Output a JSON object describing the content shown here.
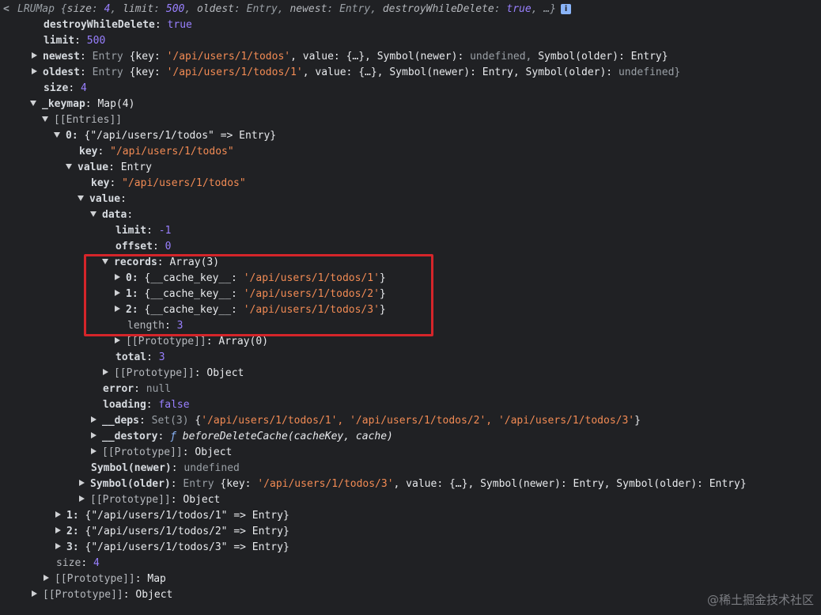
{
  "header": {
    "back_glyph": "<",
    "class_name": "LRUMap",
    "preview_open": "{",
    "preview_size_key": "size",
    "preview_size_val": "4",
    "preview_limit_key": "limit",
    "preview_limit_val": "500",
    "preview_oldest_key": "oldest",
    "preview_oldest_val": "Entry",
    "preview_newest_key": "newest",
    "preview_newest_val": "Entry",
    "preview_dwd_key": "destroyWhileDelete",
    "preview_dwd_val": "true",
    "preview_close": "…}",
    "info_glyph": "i"
  },
  "props": {
    "destroyWhileDelete": {
      "key": "destroyWhileDelete",
      "value": "true"
    },
    "limit": {
      "key": "limit",
      "value": "500"
    },
    "newest": {
      "key": "newest",
      "type": "Entry",
      "open": "{key:",
      "key_value": "'/api/users/1/todos'",
      "value_label": "value:",
      "value_preview": "{…},",
      "sym_newer_label": "Symbol(newer):",
      "sym_newer_val": "undefined,",
      "sym_older_label": "Symbol(older):",
      "sym_older_val": "Entry}"
    },
    "oldest": {
      "key": "oldest",
      "type": "Entry",
      "open": "{key:",
      "key_value": "'/api/users/1/todos/1'",
      "value_label": "value:",
      "value_preview": "{…},",
      "sym_newer_label": "Symbol(newer):",
      "sym_newer_val": "Entry,",
      "sym_older_label": "Symbol(older):",
      "sym_older_val": "undefined}"
    },
    "size": {
      "key": "size",
      "value": "4"
    }
  },
  "keymap": {
    "key": "_keymap",
    "type": "Map(4)",
    "entries_label": "[[Entries]]",
    "entry0": {
      "index": "0:",
      "summary_open": "{",
      "summary_key": "\"/api/users/1/todos\"",
      "summary_rest": "=> Entry}",
      "key_label": "key",
      "key_value": "\"/api/users/1/todos\"",
      "value_label": "value",
      "value_type": "Entry",
      "inner_key_label": "key",
      "inner_key_value": "\"/api/users/1/todos\"",
      "inner_value_label": "value",
      "data_label": "data",
      "limit_label": "limit",
      "limit_value": "-1",
      "offset_label": "offset",
      "offset_value": "0",
      "records_label": "records",
      "records_type": "Array(3)",
      "records": [
        {
          "index": "0:",
          "open": "{__cache_key__:",
          "value": "'/api/users/1/todos/1'",
          "close": "}"
        },
        {
          "index": "1:",
          "open": "{__cache_key__:",
          "value": "'/api/users/1/todos/2'",
          "close": "}"
        },
        {
          "index": "2:",
          "open": "{__cache_key__:",
          "value": "'/api/users/1/todos/3'",
          "close": "}"
        }
      ],
      "length_label": "length",
      "length_value": "3",
      "array_proto_label": "[[Prototype]]",
      "array_proto_value": "Array(0)",
      "total_label": "total",
      "total_value": "3",
      "data_proto_label": "[[Prototype]]",
      "data_proto_value": "Object",
      "error_label": "error",
      "error_value": "null",
      "loading_label": "loading",
      "loading_value": "false",
      "deps_label": "__deps",
      "deps_type": "Set(3)",
      "deps_open": "{",
      "deps_items": [
        "'/api/users/1/todos/1',",
        "'/api/users/1/todos/2',",
        "'/api/users/1/todos/3'"
      ],
      "deps_close": "}",
      "destory_label": "__destory",
      "destory_f": "ƒ",
      "destory_sig": "beforeDeleteCache(cacheKey, cache)",
      "value_proto_label": "[[Prototype]]",
      "value_proto_value": "Object",
      "sym_newer_label": "Symbol(newer)",
      "sym_newer_value": "undefined",
      "sym_older_label": "Symbol(older)",
      "sym_older_type": "Entry",
      "sym_older_open": "{key:",
      "sym_older_key": "'/api/users/1/todos/3'",
      "sym_older_mid": ", value: {…}, Symbol(newer): Entry, Symbol(older): Entry}",
      "entry_proto_label": "[[Prototype]]",
      "entry_proto_value": "Object"
    },
    "collapsed_entries": [
      {
        "index": "1:",
        "open": "{",
        "key": "\"/api/users/1/todos/1\"",
        "rest": "=> Entry}"
      },
      {
        "index": "2:",
        "open": "{",
        "key": "\"/api/users/1/todos/2\"",
        "rest": "=> Entry}"
      },
      {
        "index": "3:",
        "open": "{",
        "key": "\"/api/users/1/todos/3\"",
        "rest": "=> Entry}"
      }
    ],
    "size_label": "size",
    "size_value": "4",
    "map_proto_label": "[[Prototype]]",
    "map_proto_value": "Map"
  },
  "root_proto": {
    "label": "[[Prototype]]",
    "value": "Object"
  },
  "watermark": "@稀土掘金技术社区",
  "colors": {
    "background": "#202124",
    "highlight": "#d5252a",
    "string": "#f28b54",
    "number": "#9980ff"
  }
}
